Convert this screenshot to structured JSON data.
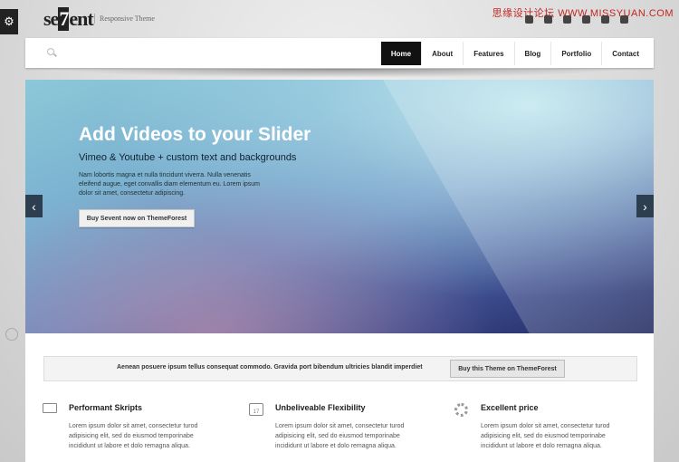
{
  "header": {
    "logo_prefix": "se",
    "logo_seven": "7",
    "logo_suffix": "ent",
    "tagline": "Responsive Theme",
    "watermark": "思缘设计论坛 WWW.MISSYUAN.COM",
    "social_icons": [
      "facebook-icon",
      "twitter-icon",
      "skype-icon",
      "dribbble-icon",
      "flickr-icon",
      "linkedin-icon"
    ]
  },
  "nav": {
    "items": [
      "Home",
      "About",
      "Features",
      "Blog",
      "Portfolio",
      "Contact"
    ],
    "active": "Home"
  },
  "slider": {
    "title": "Add Videos to your Slider",
    "subtitle": "Vimeo & Youtube + custom text and backgrounds",
    "text": "Nam lobortis magna et nulla tincidunt viverra. Nulla venenatis eleifend augue, eget convallis diam elementum eu. Lorem ipsum dolor sit amet, consectetur adipiscing.",
    "button": "Buy Sevent now on ThemeForest",
    "prev_icon": "‹",
    "next_icon": "›"
  },
  "cta": {
    "text": "Aenean posuere ipsum tellus consequat commodo. Gravida port bibendum ultricies blandit imperdiet",
    "button": "Buy this Theme on ThemeForest"
  },
  "features": [
    {
      "icon": "monitor-icon",
      "title": "Performant Skripts",
      "text": "Lorem ipsum dolor sit amet, consectetur turod adipisicing elit, sed do eiusmod temporinabe incididunt ut labore et dolo remagna aliqua."
    },
    {
      "icon": "calendar-icon",
      "title": "Unbeliveable Flexibility",
      "text": "Lorem ipsum dolor sit amet, consectetur turod adipisicing elit, sed do eiusmod temporinabe incididunt ut labore et dolo remagna aliqua.",
      "icon_text": "17"
    },
    {
      "icon": "gear-icon",
      "title": "Excellent price",
      "text": "Lorem ipsum dolor sit amet, consectetur turod adipisicing elit, sed do eiusmod temporinabe incididunt ut labore et dolo remagna aliqua."
    }
  ],
  "settings_icon": "⚙"
}
